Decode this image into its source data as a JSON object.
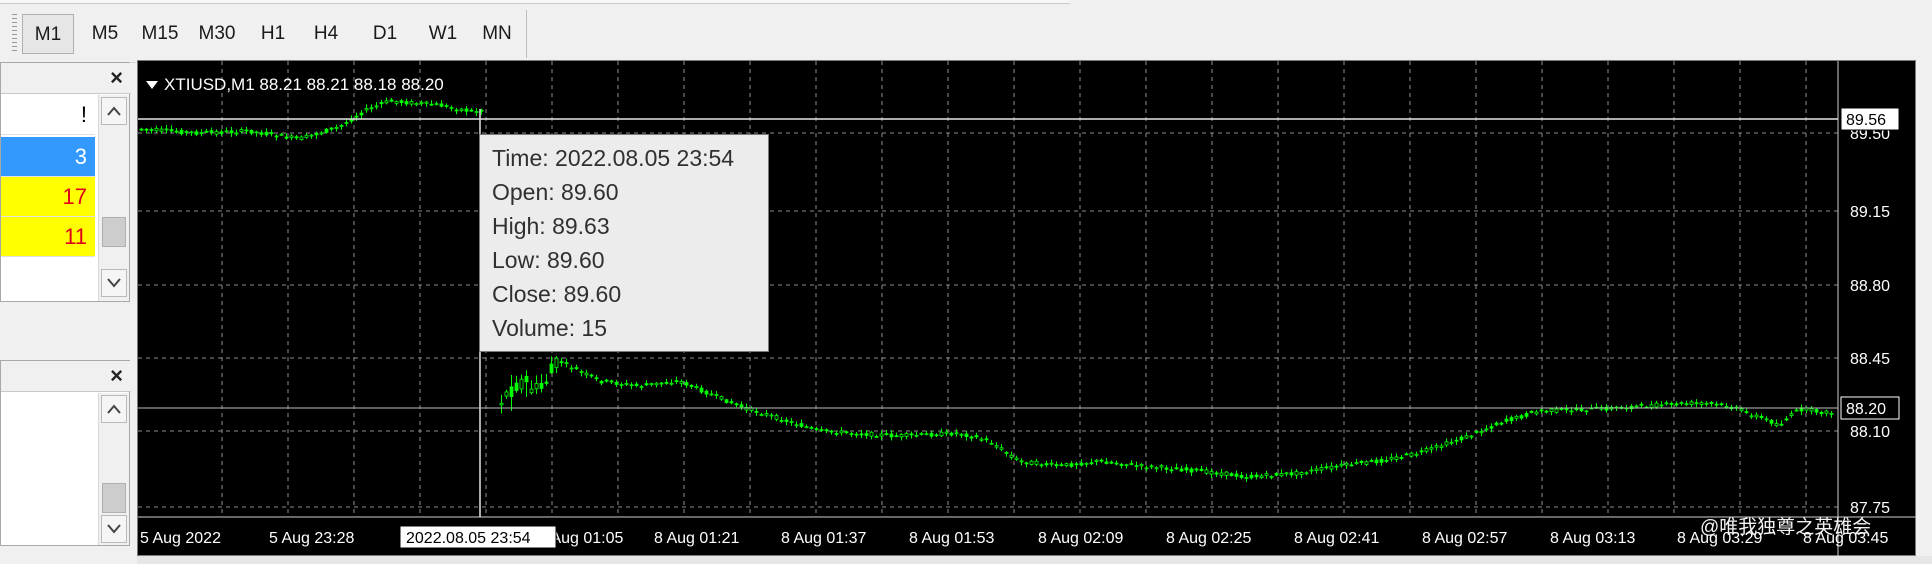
{
  "toolbar": {
    "timeframes": [
      "M1",
      "M5",
      "M15",
      "M30",
      "H1",
      "H4",
      "D1",
      "W1",
      "MN"
    ],
    "active_timeframe": "M1"
  },
  "left_panel_top": {
    "close_label": "×",
    "header_value": "!",
    "rows": [
      {
        "value": "3",
        "style": "blue"
      },
      {
        "value": "17",
        "style": "yellow"
      },
      {
        "value": "11",
        "style": "yellow"
      }
    ]
  },
  "left_panel_bottom": {
    "close_label": "×"
  },
  "chart": {
    "header": "XTIUSD,M1  88.21 88.21 88.18 88.20",
    "colors": {
      "background": "#000000",
      "candles": "#00ff00",
      "grid": "#8c8c8c",
      "axis_text": "#ffffff"
    },
    "price_labels": [
      "89.50",
      "89.15",
      "88.80",
      "88.45",
      "88.10",
      "87.75"
    ],
    "current_price_label": "89.56",
    "bid_price_label": "88.20",
    "time_labels": [
      "5 Aug 2022",
      "5 Aug 23:28",
      "2022.08.05 23:54",
      "8 Aug 01:05",
      "8 Aug 01:21",
      "8 Aug 01:37",
      "8 Aug 01:53",
      "8 Aug 02:09",
      "8 Aug 02:25",
      "8 Aug 02:41",
      "8 Aug 02:57",
      "8 Aug 03:13",
      "8 Aug 03:29",
      "8 Aug 03:45"
    ],
    "crosshair_time_label": "2022.08.05 23:54",
    "tooltip": {
      "time": "Time: 2022.08.05 23:54",
      "open": "Open: 89.60",
      "high": "High: 89.63",
      "low": "Low:  89.60",
      "close": "Close: 89.60",
      "volume": "Volume: 15"
    },
    "watermark": "@唯我独尊之英雄会"
  }
}
